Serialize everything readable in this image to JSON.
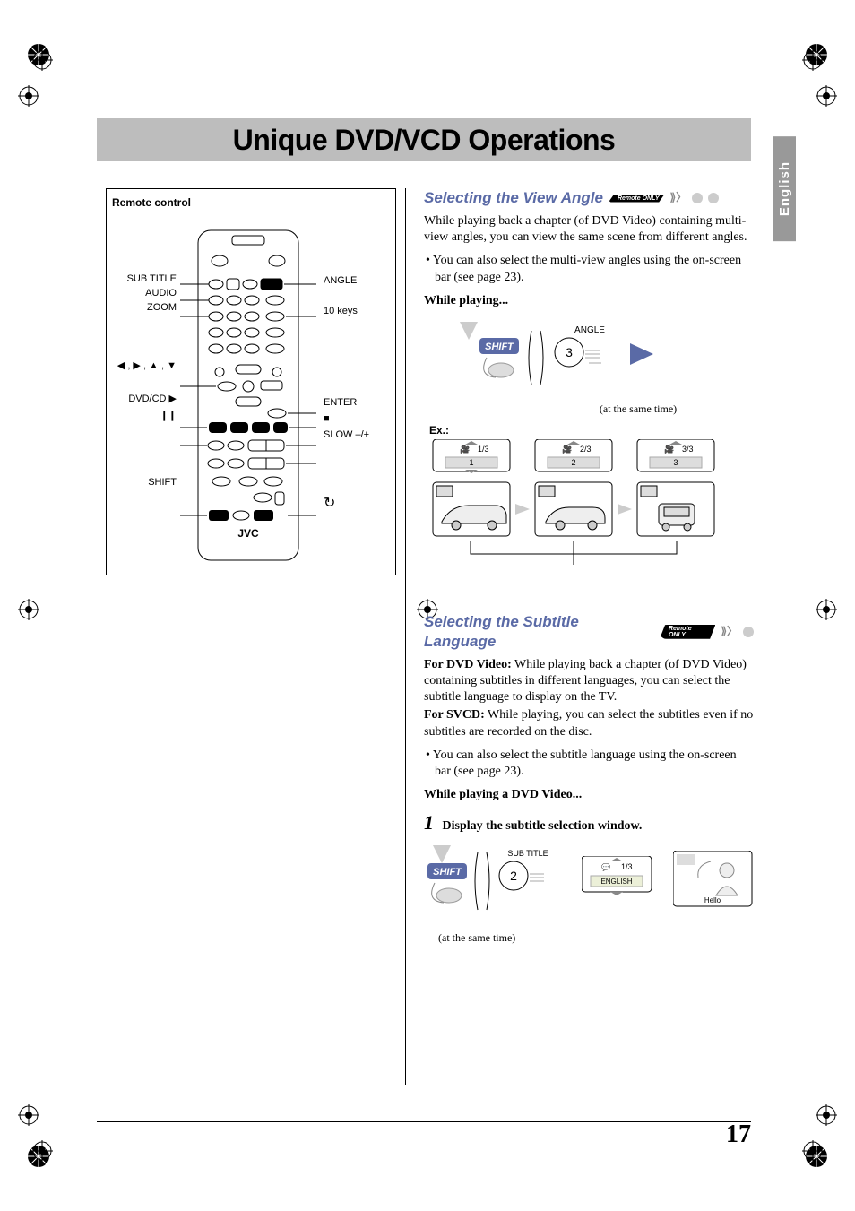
{
  "page": {
    "title": "Unique DVD/VCD Operations",
    "language_tab": "English",
    "number": "17"
  },
  "remote": {
    "box_title": "Remote control",
    "brand": "JVC",
    "labels_left": {
      "sub_title": "SUB TITLE",
      "audio": "AUDIO",
      "zoom": "ZOOM",
      "arrows": "◀ , ▶ , ▲ , ▼",
      "dvd_cd": "DVD/CD ▶",
      "pause": "❙❙",
      "shift": "SHIFT"
    },
    "labels_right": {
      "angle": "ANGLE",
      "ten_keys": "10 keys",
      "enter": "ENTER",
      "stop": "■",
      "slow": "SLOW –/+",
      "repeat": "↻"
    }
  },
  "section_angle": {
    "heading": "Selecting the View Angle",
    "badge": "Remote ONLY",
    "p1": "While playing back a chapter (of DVD Video) containing multi-view angles, you can view the same scene from different angles.",
    "bullet1": "• You can also select the multi-view angles using the on-screen bar (see page 23).",
    "while_playing": "While playing...",
    "shift": "SHIFT",
    "angle_label": "ANGLE",
    "key": "3",
    "caption": "(at the same time)",
    "ex": "Ex.:",
    "angles": [
      "1/3",
      "2/3",
      "3/3"
    ],
    "nums": [
      "1",
      "2",
      "3"
    ]
  },
  "section_subtitle": {
    "heading": "Selecting the Subtitle Language",
    "badge": "Remote ONLY",
    "p1_lead": "For DVD Video:",
    "p1": " While playing back a chapter (of DVD Video) containing subtitles in different languages, you can select the subtitle language to display on the TV.",
    "p2_lead": "For SVCD:",
    "p2": " While playing, you can select the subtitles even if no subtitles are recorded on the disc.",
    "bullet1": "• You can also select the subtitle language using the on-screen bar (see page 23).",
    "while_playing": "While playing a DVD Video...",
    "step1": "Display the subtitle selection window.",
    "shift": "SHIFT",
    "subtitle_label": "SUB TITLE",
    "key": "2",
    "osd_index": "1/3",
    "osd_lang": "ENGLISH",
    "caption": "(at the same time)",
    "hello": "Hello"
  }
}
